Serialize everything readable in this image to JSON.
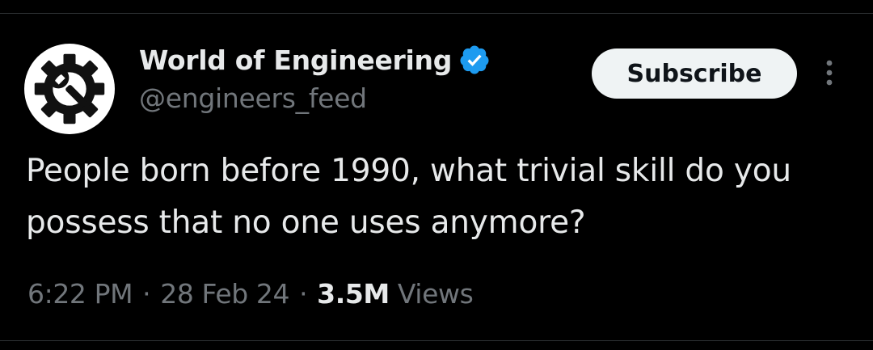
{
  "author": {
    "display_name": "World of Engineering",
    "handle": "@engineers_feed",
    "verified_color": "#1d9bf0",
    "avatar_icon": "gear-wrench-icon"
  },
  "actions": {
    "subscribe_label": "Subscribe",
    "more_icon": "more-vertical-icon"
  },
  "tweet": {
    "text": "People born before 1990, what trivial skill do you possess that no one uses anymore?",
    "time": "6:22 PM",
    "date": "28 Feb 24",
    "separator": "·",
    "views_count": "3.5M",
    "views_label": "Views"
  },
  "colors": {
    "background": "#000000",
    "primary_text": "#e7e9ea",
    "secondary_text": "#71767b",
    "button_bg": "#eff3f4"
  }
}
